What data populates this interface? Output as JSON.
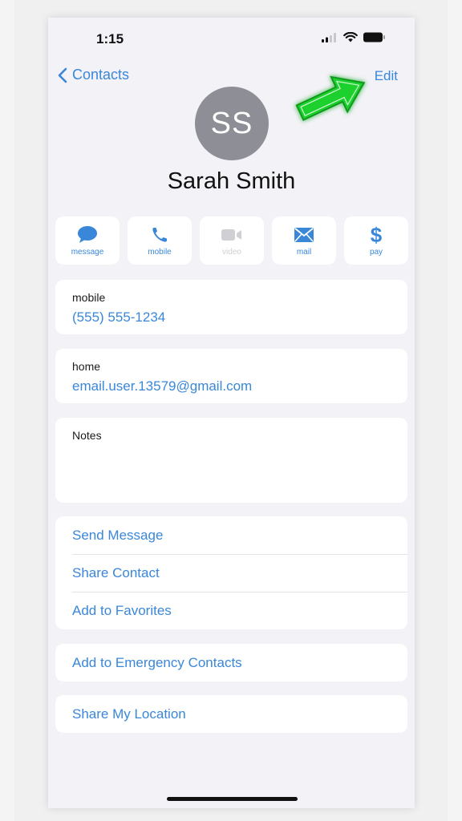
{
  "status_bar": {
    "time": "1:15",
    "icons": [
      "cellular-signal-icon",
      "wifi-icon",
      "battery-icon"
    ]
  },
  "nav": {
    "back_label": "Contacts",
    "back_icon": "chevron-left-icon",
    "edit_label": "Edit"
  },
  "annotation": {
    "icon": "green-arrow-icon",
    "color": "#22dd33",
    "points_to": "Edit"
  },
  "contact": {
    "initials": "SS",
    "name": "Sarah Smith"
  },
  "actions": [
    {
      "label": "message",
      "icon": "message-bubble-icon",
      "enabled": true
    },
    {
      "label": "mobile",
      "icon": "phone-icon",
      "enabled": true
    },
    {
      "label": "video",
      "icon": "video-camera-icon",
      "enabled": false
    },
    {
      "label": "mail",
      "icon": "envelope-icon",
      "enabled": true
    },
    {
      "label": "pay",
      "icon": "dollar-icon",
      "enabled": true
    }
  ],
  "fields": {
    "phone": {
      "label": "mobile",
      "value": "(555) 555-1234"
    },
    "email": {
      "label": "home",
      "value": "email.user.13579@gmail.com"
    },
    "notes": {
      "label": "Notes",
      "value": ""
    }
  },
  "options_group": [
    {
      "label": "Send Message"
    },
    {
      "label": "Share Contact"
    },
    {
      "label": "Add to Favorites"
    }
  ],
  "emergency": {
    "label": "Add to Emergency Contacts"
  },
  "location": {
    "label": "Share My Location"
  },
  "colors": {
    "accent": "#3a87d9",
    "background": "#f2f2f7",
    "card": "#ffffff",
    "avatar": "#8e8e96"
  }
}
